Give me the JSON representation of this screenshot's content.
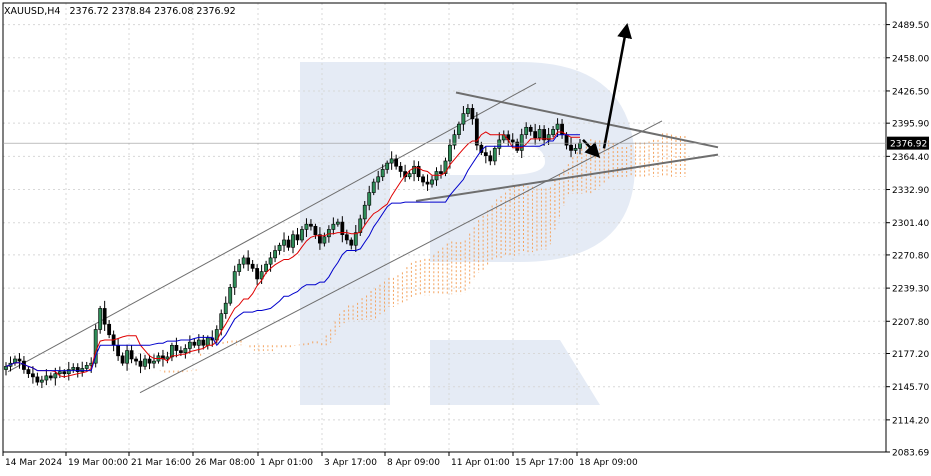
{
  "header": {
    "symbol_timeframe": "XAUUSD,H4",
    "ohlc": "2376.72 2378.84 2376.08 2376.92"
  },
  "colors": {
    "bull_body": "#2e8b57",
    "bear_body": "#2e8b57",
    "tenkan": "#e00000",
    "kijun": "#0000cc",
    "kumo": "#f4a460",
    "trend_lines": "#6e6e6e",
    "watermark": "#dfe6f2",
    "price_tag_bg": "#000000",
    "price_tag_fg": "#ffffff"
  },
  "chart_data": {
    "type": "candlestick",
    "symbol": "XAUUSD",
    "timeframe": "H4",
    "last_price": 2376.92,
    "last_price_label": "2376.92",
    "ylim": [
      2083.69,
      2510
    ],
    "y_ticks": [
      2489.5,
      2458.0,
      2426.5,
      2395.9,
      2364.4,
      2332.9,
      2301.4,
      2270.8,
      2239.3,
      2207.8,
      2177.2,
      2145.7,
      2114.2,
      2083.69
    ],
    "y_tick_labels": [
      "2489.50",
      "2458.00",
      "2426.50",
      "2395.90",
      "2364.40",
      "2332.90",
      "2301.40",
      "2270.80",
      "2239.30",
      "2207.80",
      "2177.20",
      "2145.70",
      "2114.20",
      "2083.69"
    ],
    "x_tick_labels": [
      "14 Mar 2024",
      "19 Mar 00:00",
      "21 Mar 16:00",
      "26 Mar 08:00",
      "1 Apr 01:00",
      "3 Apr 17:00",
      "8 Apr 09:00",
      "11 Apr 01:00",
      "15 Apr 17:00",
      "18 Apr 09:00"
    ],
    "candles_close": [
      2165,
      2168,
      2172,
      2170,
      2162,
      2158,
      2155,
      2150,
      2152,
      2156,
      2154,
      2158,
      2160,
      2158,
      2162,
      2164,
      2160,
      2163,
      2166,
      2168,
      2200,
      2220,
      2205,
      2195,
      2185,
      2175,
      2168,
      2180,
      2172,
      2170,
      2165,
      2172,
      2168,
      2170,
      2175,
      2172,
      2174,
      2185,
      2180,
      2178,
      2182,
      2188,
      2185,
      2190,
      2185,
      2192,
      2190,
      2200,
      2215,
      2225,
      2240,
      2255,
      2262,
      2268,
      2262,
      2258,
      2248,
      2255,
      2262,
      2268,
      2275,
      2280,
      2285,
      2278,
      2290,
      2285,
      2295,
      2300,
      2298,
      2290,
      2282,
      2288,
      2295,
      2300,
      2302,
      2290,
      2285,
      2280,
      2292,
      2305,
      2318,
      2330,
      2340,
      2345,
      2352,
      2358,
      2362,
      2355,
      2350,
      2345,
      2348,
      2355,
      2345,
      2340,
      2338,
      2342,
      2350,
      2348,
      2360,
      2375,
      2385,
      2395,
      2405,
      2410,
      2400,
      2375,
      2368,
      2365,
      2360,
      2372,
      2380,
      2385,
      2380,
      2378,
      2370,
      2385,
      2392,
      2388,
      2382,
      2390,
      2380,
      2385,
      2390,
      2395,
      2385,
      2375,
      2370,
      2372,
      2376.92
    ]
  },
  "annotations": {
    "arrow_down_target": "triangle apex retest",
    "arrow_up_target": "breakout continuation"
  }
}
